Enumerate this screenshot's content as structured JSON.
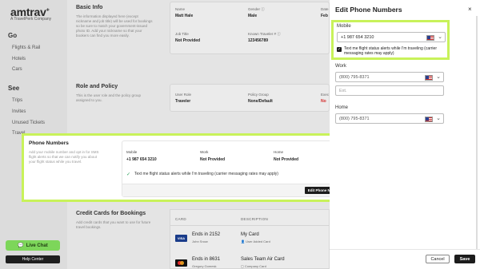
{
  "brand": {
    "name": "amtrav",
    "tagline": "A TravelPerk Company"
  },
  "sidebar": {
    "go_heading": "Go",
    "go_items": [
      "Flights & Rail",
      "Hotels",
      "Cars"
    ],
    "see_heading": "See",
    "see_items": [
      "Trips",
      "Invites",
      "Unused Tickets",
      "Travel"
    ],
    "live_chat": "Live Chat",
    "help_center": "Help Center"
  },
  "basic_info": {
    "heading": "Basic Info",
    "description": "The information displayed here (except nickname and job title) will be used for bookings so be sure to match your government-issued photo ID. Add your nickname so that your bookers can find you more easily.",
    "name_label": "Name",
    "name_value": "Matt Hale",
    "gender_label": "Gender",
    "gender_value": "Male",
    "date_label": "Date",
    "date_value": "Feb",
    "job_title_label": "Job Title",
    "job_title_value": "Not Provided",
    "ktn_label": "Known Traveler #",
    "ktn_value": "123456789"
  },
  "role": {
    "heading": "Role and Policy",
    "description": "This is the user role and the policy group assigned to you.",
    "user_role_label": "User Role",
    "user_role_value": "Traveler",
    "policy_label": "Policy Group",
    "policy_value": "None/Default",
    "exec_label": "Exec",
    "exec_value": "No"
  },
  "phone_numbers": {
    "heading": "Phone Numbers",
    "description": "Add your mobile number and opt in for SMS flight alerts so that we can notify you about your flight status while you travel.",
    "mobile_label": "Mobile",
    "mobile_value": "+1 987 654 3210",
    "work_label": "Work",
    "work_value": "Not Provided",
    "home_label": "Home",
    "home_value": "Not Provided",
    "alert_text": "Text me flight status alerts while I'm traveling (carrier messaging rates may apply)",
    "edit_button": "Edit Phone Numbers"
  },
  "credit_cards": {
    "heading": "Credit Cards for Bookings",
    "description": "Add credit cards that you want to use for future travel bookings.",
    "col_card": "CARD",
    "col_description": "DESCRIPTION",
    "cards": [
      {
        "ending": "Ends in 2152",
        "holder": "John Snow",
        "description": "My Card",
        "type": "User Added Card"
      },
      {
        "ending": "Ends in 8631",
        "holder": "Gregory Gomesk",
        "description": "Sales Team Air Card",
        "type": "Company Card"
      }
    ],
    "visa_text": "VISA"
  },
  "modal": {
    "title": "Edit Phone Numbers",
    "close": "×",
    "mobile_label": "Mobile",
    "mobile_value": "+1 987 654 3210",
    "mobile_checkbox": "Text me flight status alerts while I'm traveling (carrier messaging rates may apply)",
    "work_label": "Work",
    "work_placeholder": "(800) 795-8371",
    "ext_placeholder": "Ext.",
    "home_label": "Home",
    "home_placeholder": "(800) 795-8371",
    "cancel": "Cancel",
    "save": "Save"
  }
}
